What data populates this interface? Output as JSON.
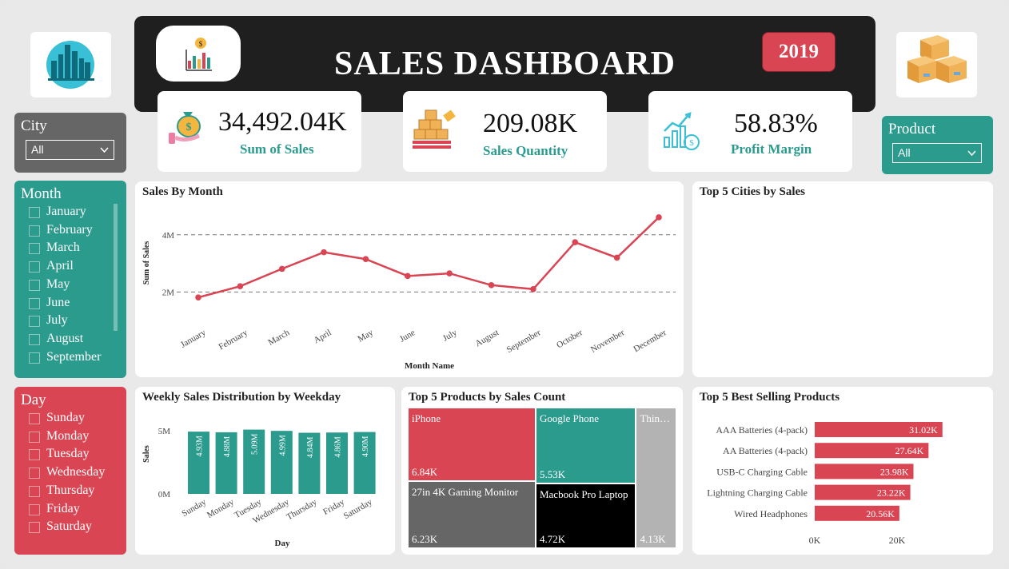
{
  "header": {
    "title": "SALES DASHBOARD",
    "year": "2019"
  },
  "icons": {
    "city": "city-skyline-icon",
    "boxes": "boxes-icon",
    "chart": "money-chart-icon"
  },
  "kpis": [
    {
      "value": "34,492.04K",
      "label": "Sum of Sales",
      "icon": "money-bag-hand-icon"
    },
    {
      "value": "209.08K",
      "label": "Sales Quantity",
      "icon": "pallet-boxes-icon"
    },
    {
      "value": "58.83%",
      "label": "Profit Margin",
      "icon": "growth-chart-icon"
    }
  ],
  "slicers": {
    "city": {
      "title": "City",
      "value": "All"
    },
    "product": {
      "title": "Product",
      "value": "All"
    },
    "month": {
      "title": "Month",
      "items": [
        "January",
        "February",
        "March",
        "April",
        "May",
        "June",
        "July",
        "August",
        "September"
      ]
    },
    "day": {
      "title": "Day",
      "items": [
        "Sunday",
        "Monday",
        "Tuesday",
        "Wednesday",
        "Thursday",
        "Friday",
        "Saturday"
      ]
    }
  },
  "colors": {
    "red": "#d94553",
    "teal": "#2b9b8e",
    "gray": "#666666",
    "dark": "#1f1f1f"
  },
  "chart_data": [
    {
      "type": "line",
      "title": "Sales By Month",
      "xlabel": "Month Name",
      "ylabel": "Sum of Sales",
      "x": [
        "January",
        "February",
        "March",
        "April",
        "May",
        "June",
        "July",
        "August",
        "September",
        "October",
        "November",
        "December"
      ],
      "values": [
        1.81,
        2.2,
        2.81,
        3.39,
        3.15,
        2.56,
        2.65,
        2.24,
        2.1,
        3.74,
        3.2,
        4.61
      ],
      "y_ticks": [
        "2M",
        "4M"
      ],
      "ylim": [
        1.2,
        5.0
      ],
      "grid": true
    },
    {
      "type": "bar",
      "title": "Weekly Sales Distribution by Weekday",
      "xlabel": "Day",
      "ylabel": "Sales",
      "categories": [
        "Sunday",
        "Monday",
        "Tuesday",
        "Wednesday",
        "Thursday",
        "Friday",
        "Saturday"
      ],
      "values": [
        4.93,
        4.88,
        5.09,
        4.99,
        4.84,
        4.86,
        4.9
      ],
      "data_labels": [
        "4.93M",
        "4.88M",
        "5.09M",
        "4.99M",
        "4.84M",
        "4.86M",
        "4.90M"
      ],
      "y_ticks": [
        "0M",
        "5M"
      ],
      "ylim": [
        0,
        5
      ]
    },
    {
      "type": "treemap",
      "title": "Top 5 Products by Sales Count",
      "items": [
        {
          "name": "iPhone",
          "label": "6.84K",
          "value": 6.84
        },
        {
          "name": "Google Phone",
          "label": "5.53K",
          "value": 5.53
        },
        {
          "name": "Thin…",
          "label": "4.13K",
          "value": 4.13
        },
        {
          "name": "27in 4K Gaming Monitor",
          "label": "6.23K",
          "value": 6.23
        },
        {
          "name": "Macbook Pro Laptop",
          "label": "4.72K",
          "value": 4.72
        }
      ]
    },
    {
      "type": "bar",
      "orientation": "horizontal",
      "title": "Top 5 Best Selling Products",
      "categories": [
        "AAA Batteries (4-pack)",
        "AA Batteries (4-pack)",
        "USB-C Charging Cable",
        "Lightning Charging Cable",
        "Wired Headphones"
      ],
      "values": [
        31.02,
        27.64,
        23.98,
        23.22,
        20.56
      ],
      "data_labels": [
        "31.02K",
        "27.64K",
        "23.98K",
        "23.22K",
        "20.56K"
      ],
      "x_ticks": [
        "0K",
        "20K"
      ],
      "xlim": [
        0,
        37
      ]
    },
    {
      "type": "bar",
      "title": "Top 5 Cities by Sales",
      "categories": [],
      "values": []
    }
  ]
}
